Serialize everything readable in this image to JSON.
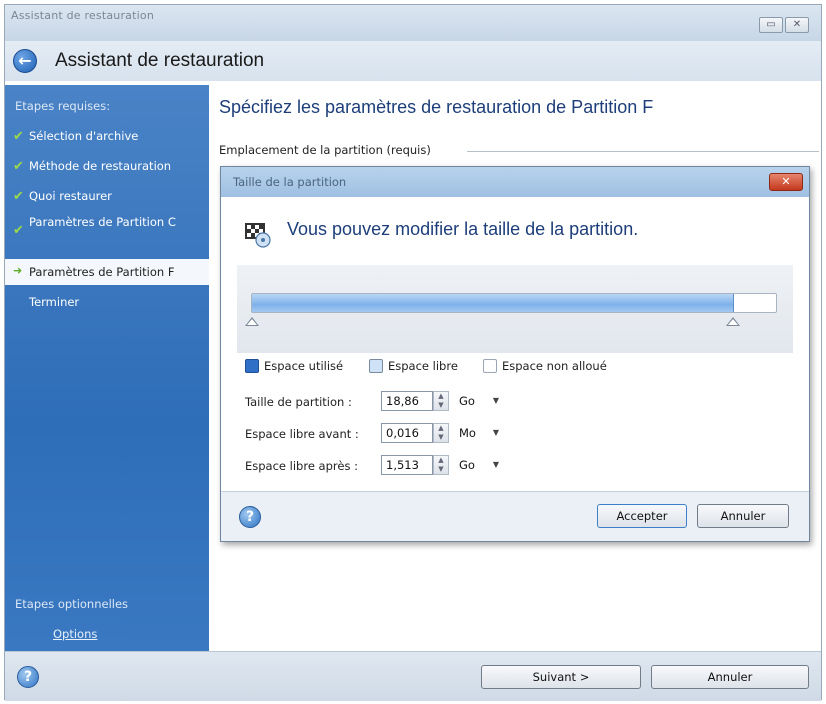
{
  "window": {
    "caption": "Assistant de restauration",
    "title": "Assistant de restauration"
  },
  "sidebar": {
    "required_title": "Etapes requises:",
    "steps": [
      {
        "label": "Sélection d'archive",
        "done": true
      },
      {
        "label": "Méthode de restauration",
        "done": true
      },
      {
        "label": "Quoi restaurer",
        "done": true
      },
      {
        "label": "Paramètres de Partition C",
        "done": true
      },
      {
        "label": "Paramètres de Partition F",
        "current": true
      },
      {
        "label": "Terminer"
      }
    ],
    "optional_title": "Etapes optionnelles",
    "options_link": "Options"
  },
  "main": {
    "title": "Spécifiez les paramètres de restauration de Partition F",
    "group_label": "Emplacement de la partition (requis)"
  },
  "dialog": {
    "caption": "Taille de la partition",
    "heading": "Vous pouvez modifier la taille de la partition.",
    "slider": {
      "used_fraction": 0.92
    },
    "legend": {
      "used": "Espace utilisé",
      "free": "Espace libre",
      "unallocated": "Espace non alloué"
    },
    "fields": {
      "size_label": "Taille de partition :",
      "size_value": "18,86",
      "size_unit": "Go",
      "before_label": "Espace libre avant :",
      "before_value": "0,016",
      "before_unit": "Mo",
      "after_label": "Espace libre après :",
      "after_value": "1,513",
      "after_unit": "Go"
    },
    "accept": "Accepter",
    "cancel": "Annuler"
  },
  "footer": {
    "next": "Suivant >",
    "cancel": "Annuler"
  },
  "colors": {
    "accent_blue": "#1d3e7a",
    "sidebar": "#2e6db8",
    "check_green": "#9cd84a"
  }
}
